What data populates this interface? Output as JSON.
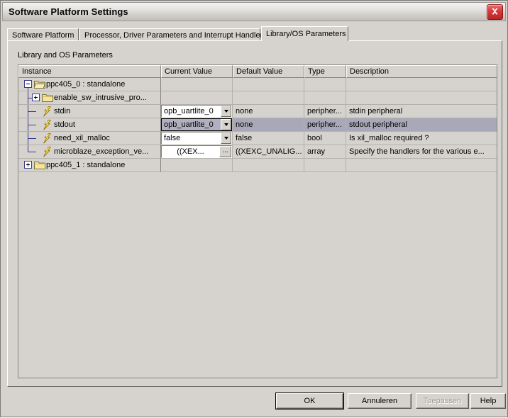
{
  "window": {
    "title": "Software Platform Settings",
    "close_icon": "close-x-icon"
  },
  "tabs": [
    {
      "label": "Software Platform",
      "active": false
    },
    {
      "label": "Processor, Driver Parameters and Interrupt Handlers",
      "active": false
    },
    {
      "label": "Library/OS Parameters",
      "active": true
    }
  ],
  "panel": {
    "group_label": "Library and OS Parameters"
  },
  "table": {
    "columns": [
      "Instance",
      "Current Value",
      "Default Value",
      "Type",
      "Description"
    ],
    "rows": [
      {
        "instance": "ppc405_0 : standalone",
        "icon": "open-folder-icon",
        "expander": "minus",
        "depth": 0,
        "current_value": "",
        "current_widget": "none",
        "default_value": "",
        "type": "",
        "description": "",
        "selected": false
      },
      {
        "instance": "enable_sw_intrusive_pro...",
        "icon": "folder-icon",
        "expander": "plus",
        "depth": 1,
        "current_value": "",
        "current_widget": "none",
        "default_value": "",
        "type": "",
        "description": "",
        "selected": false
      },
      {
        "instance": "stdin",
        "icon": "parameter-bolt-icon",
        "expander": "none",
        "depth": 2,
        "current_value": "opb_uartlite_0",
        "current_widget": "combo",
        "default_value": "none",
        "type": "peripher...",
        "description": "stdin peripheral",
        "selected": false
      },
      {
        "instance": "stdout",
        "icon": "parameter-bolt-icon",
        "expander": "none",
        "depth": 2,
        "current_value": "opb_uartlite_0",
        "current_widget": "combo-focused",
        "default_value": "none",
        "type": "peripher...",
        "description": "stdout peripheral",
        "selected": true
      },
      {
        "instance": "need_xil_malloc",
        "icon": "parameter-bolt-icon",
        "expander": "none",
        "depth": 2,
        "current_value": "false",
        "current_widget": "combo",
        "default_value": "false",
        "type": "bool",
        "description": "Is xil_malloc required ?",
        "selected": false
      },
      {
        "instance": "microblaze_exception_ve...",
        "icon": "parameter-bolt-icon",
        "expander": "none",
        "depth": 2,
        "current_value": "((XEX...",
        "current_widget": "ellipsis",
        "ellipsis_label": "...",
        "default_value": "((XEXC_UNALIG...",
        "type": "array",
        "description": "Specify the handlers for the various e...",
        "selected": false
      },
      {
        "instance": "ppc405_1 : standalone",
        "icon": "folder-icon",
        "expander": "plus",
        "depth": 0,
        "current_value": "",
        "current_widget": "none",
        "default_value": "",
        "type": "",
        "description": "",
        "selected": false
      }
    ]
  },
  "buttons": {
    "ok": "OK",
    "cancel": "Annuleren",
    "apply": "Toepassen",
    "help": "Help"
  },
  "colors": {
    "window_face": "#d6d3ce",
    "selection": "#a8a8b8",
    "close_red": "#d33b3b",
    "tree_line": "#3b3b8c",
    "folder_yellow": "#f5e49a"
  }
}
